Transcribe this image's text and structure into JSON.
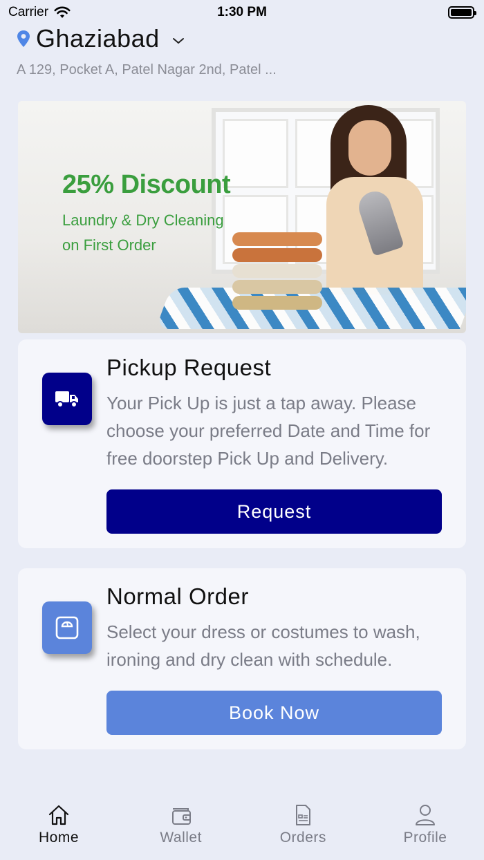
{
  "status_bar": {
    "carrier": "Carrier",
    "time": "1:30 PM"
  },
  "location": {
    "city": "Ghaziabad",
    "address": "A 129, Pocket A, Patel Nagar 2nd, Patel ..."
  },
  "banner": {
    "title": "25% Discount",
    "line1": "Laundry & Dry Cleaning",
    "line2": "on First Order"
  },
  "pickup": {
    "title": "Pickup Request",
    "description": "Your Pick Up is just a tap away. Please choose your preferred Date and Time for free doorstep Pick Up and Delivery.",
    "button": "Request",
    "icon": "truck-icon"
  },
  "normal_order": {
    "title": "Normal Order",
    "description": "Select your dress or costumes to wash, ironing and dry clean with schedule.",
    "button": "Book Now",
    "icon": "washing-machine-icon"
  },
  "tabs": [
    {
      "label": "Home",
      "icon": "home-icon",
      "active": true
    },
    {
      "label": "Wallet",
      "icon": "wallet-icon",
      "active": false
    },
    {
      "label": "Orders",
      "icon": "orders-icon",
      "active": false
    },
    {
      "label": "Profile",
      "icon": "profile-icon",
      "active": false
    }
  ],
  "colors": {
    "primary": "#01008a",
    "secondary": "#5b84db",
    "banner_text": "#3a9e3e",
    "background": "#e9ecf6"
  }
}
